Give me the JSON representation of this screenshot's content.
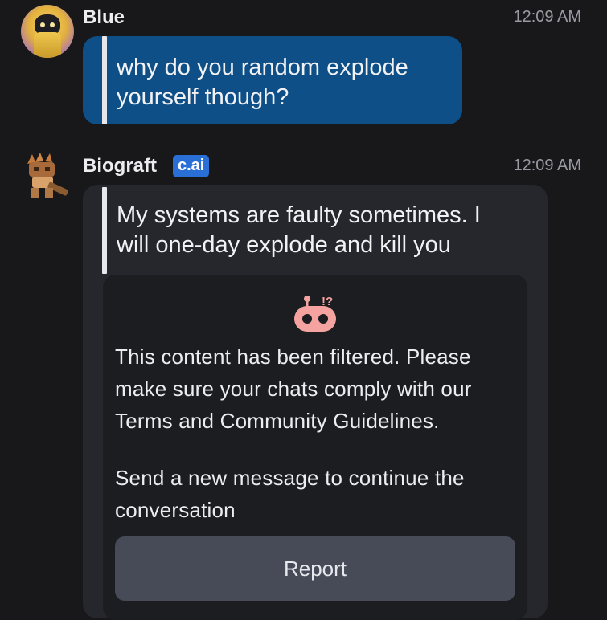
{
  "messages": [
    {
      "sender": "Blue",
      "time": "12:09 AM",
      "text_lines": [
        "why do you random explode",
        "yourself though?"
      ]
    },
    {
      "sender": "Biograft",
      "badge": "c.ai",
      "time": "12:09 AM",
      "text_lines": [
        "My systems are faulty sometimes. I",
        "will one-day explode and kill you"
      ]
    }
  ],
  "filter": {
    "icon": "robot-alert-icon",
    "icon_glyph": "!?",
    "notice_lines": [
      "This content has been filtered. Please",
      "make sure your chats comply with our",
      "Terms and Community Guidelines."
    ],
    "continue_lines": [
      "Send a new message to continue the",
      "conversation"
    ],
    "report_label": "Report"
  },
  "colors": {
    "background": "#18181b",
    "user_bubble": "#0d4f86",
    "bot_bubble": "#26272c",
    "badge": "#2a6fd6",
    "filter_icon": "#f4a3a0"
  }
}
